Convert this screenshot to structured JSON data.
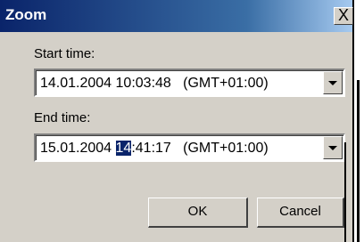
{
  "window": {
    "title": "Zoom",
    "close_symbol": "X"
  },
  "start": {
    "label": "Start time:",
    "date": "14.01.2004 10:03:48",
    "timezone": "(GMT+01:00)"
  },
  "end": {
    "label": "End time:",
    "date_before": "15.01.2004 ",
    "date_selected": "14",
    "date_after": ":41:17",
    "timezone": "(GMT+01:00)"
  },
  "buttons": {
    "ok": "OK",
    "cancel": "Cancel"
  },
  "colors": {
    "title_bar": "#0a246a",
    "face": "#d4d0c8",
    "selection": "#0a246a"
  },
  "icons": {
    "dropdown": "chevron-down-icon",
    "close": "close-icon"
  }
}
